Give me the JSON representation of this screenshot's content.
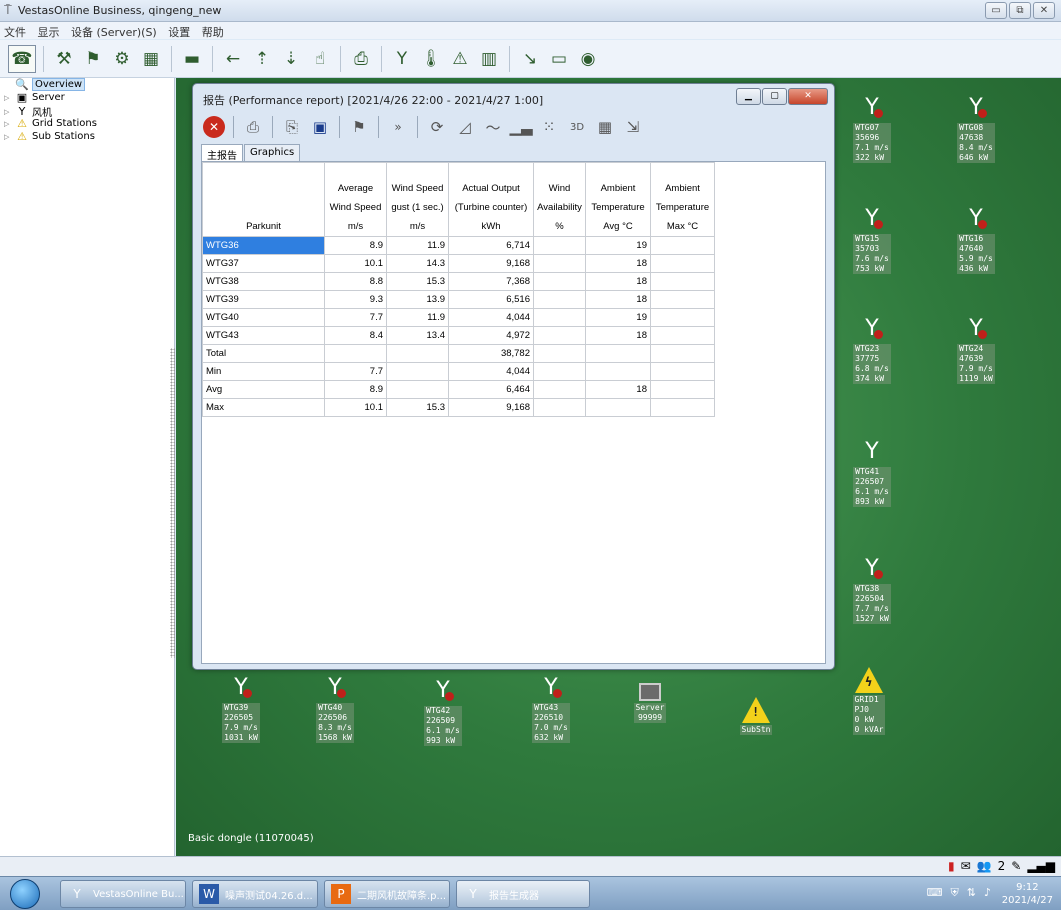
{
  "window": {
    "title": "VestasOnline Business, qingeng_new"
  },
  "menu": [
    "文件",
    "显示",
    "设备 (Server)(S)",
    "设置",
    "帮助"
  ],
  "tree": [
    "Overview",
    "Server",
    "风机",
    "Grid Stations",
    "Sub Stations"
  ],
  "report": {
    "title": "报告 (Performance report) [2021/4/26 22:00 - 2021/4/27 1:00]",
    "toolbar_more": "»",
    "tabs": [
      "主报告",
      "Graphics"
    ],
    "headers": {
      "parkunit": "Parkunit",
      "avg_wind": [
        "Average",
        "Wind Speed",
        "m/s"
      ],
      "gust": [
        "Wind Speed",
        "gust (1 sec.)",
        "m/s"
      ],
      "output": [
        "Actual Output",
        "(Turbine counter)",
        "kWh"
      ],
      "avail": [
        "Wind",
        "Availability",
        "%"
      ],
      "temp_avg": [
        "Ambient",
        "Temperature",
        "Avg °C"
      ],
      "temp_max": [
        "Ambient",
        "Temperature",
        "Max °C"
      ]
    },
    "rows": [
      {
        "name": "WTG36",
        "avg": "8.9",
        "gust": "11.9",
        "output": "6,714",
        "avail": "",
        "tavg": "19",
        "tmax": ""
      },
      {
        "name": "WTG37",
        "avg": "10.1",
        "gust": "14.3",
        "output": "9,168",
        "avail": "",
        "tavg": "18",
        "tmax": ""
      },
      {
        "name": "WTG38",
        "avg": "8.8",
        "gust": "15.3",
        "output": "7,368",
        "avail": "",
        "tavg": "18",
        "tmax": ""
      },
      {
        "name": "WTG39",
        "avg": "9.3",
        "gust": "13.9",
        "output": "6,516",
        "avail": "",
        "tavg": "18",
        "tmax": ""
      },
      {
        "name": "WTG40",
        "avg": "7.7",
        "gust": "11.9",
        "output": "4,044",
        "avail": "",
        "tavg": "19",
        "tmax": ""
      },
      {
        "name": "WTG43",
        "avg": "8.4",
        "gust": "13.4",
        "output": "4,972",
        "avail": "",
        "tavg": "18",
        "tmax": ""
      },
      {
        "name": "Total",
        "avg": "",
        "gust": "",
        "output": "38,782",
        "avail": "",
        "tavg": "",
        "tmax": ""
      },
      {
        "name": "Min",
        "avg": "7.7",
        "gust": "",
        "output": "4,044",
        "avail": "",
        "tavg": "",
        "tmax": ""
      },
      {
        "name": "Avg",
        "avg": "8.9",
        "gust": "",
        "output": "6,464",
        "avail": "",
        "tavg": "18",
        "tmax": ""
      },
      {
        "name": "Max",
        "avg": "10.1",
        "gust": "15.3",
        "output": "9,168",
        "avail": "",
        "tavg": "",
        "tmax": ""
      }
    ],
    "selected_row": "WTG36"
  },
  "turbines": [
    {
      "lines": [
        "WTG07",
        "35696",
        "7.1 m/s",
        "322 kW"
      ]
    },
    {
      "lines": [
        "WTG08",
        "47638",
        "8.4 m/s",
        "646 kW"
      ]
    },
    {
      "lines": [
        "WTG15",
        "35703",
        "7.6 m/s",
        "753 kW"
      ]
    },
    {
      "lines": [
        "WTG16",
        "47640",
        "5.9 m/s",
        "436 kW"
      ]
    },
    {
      "lines": [
        "WTG23",
        "37775",
        "6.8 m/s",
        "374 kW"
      ]
    },
    {
      "lines": [
        "WTG24",
        "47639",
        "7.9 m/s",
        "1119 kW"
      ]
    },
    {
      "lines": [
        "WTG41",
        "226507",
        "6.1 m/s",
        "893 kW"
      ]
    },
    {
      "lines": [
        "WTG38",
        "226504",
        "7.7 m/s",
        "1527 kW"
      ]
    },
    {
      "lines": [
        "WTG39",
        "226505",
        "7.9 m/s",
        "1031 kW"
      ]
    },
    {
      "lines": [
        "WTG40",
        "226506",
        "8.3 m/s",
        "1568 kW"
      ]
    },
    {
      "lines": [
        "WTG42",
        "226509",
        "6.1 m/s",
        "993 kW"
      ]
    },
    {
      "lines": [
        "WTG43",
        "226510",
        "7.0 m/s",
        "632 kW"
      ]
    }
  ],
  "server": {
    "lines": [
      "Server",
      "99999"
    ]
  },
  "substation": {
    "label": "SubStn"
  },
  "grid": {
    "lines": [
      "GRID1",
      "PJ0",
      "0 kW",
      "0 kVAr"
    ]
  },
  "status": {
    "dongle": "Basic dongle (11070045)",
    "tray_count": "2"
  },
  "taskbar": {
    "items": [
      "VestasOnline Bu...",
      "噪声测试04.26.d...",
      "二期风机故障条.p...",
      "报告生成器"
    ],
    "time": "9:12",
    "date": "2021/4/27"
  },
  "colors": {
    "map_green": "#2f7a3d",
    "alarm_red": "#c0201a",
    "selection_blue": "#2f7fe0",
    "warning_yellow": "#f3d21a"
  }
}
